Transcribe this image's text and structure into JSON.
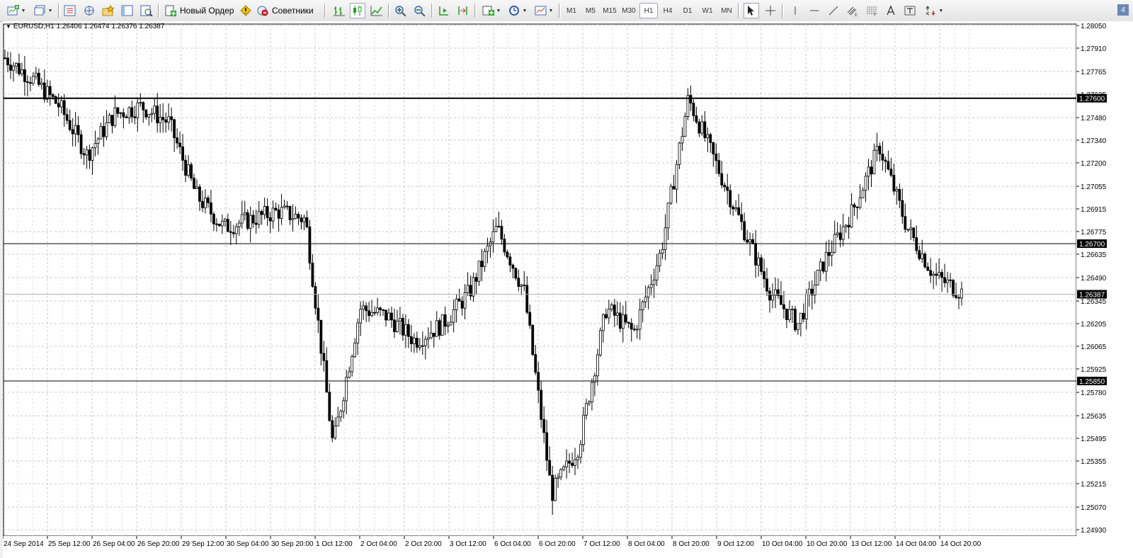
{
  "toolbar": {
    "new_order_label": "Новый Ордер",
    "experts_label": "Советники",
    "timeframes": [
      "M1",
      "M5",
      "M15",
      "M30",
      "H1",
      "H4",
      "D1",
      "W1",
      "MN"
    ],
    "active_timeframe": "H1",
    "corner_badge": "4"
  },
  "chart": {
    "symbol_info": "EURUSD,H1  1.26406 1.26474 1.26376 1.26387",
    "y_ticks": [
      "1.28050",
      "1.27910",
      "1.27765",
      "1.27625",
      "1.27480",
      "1.27340",
      "1.27200",
      "1.27055",
      "1.26915",
      "1.26775",
      "1.26635",
      "1.26490",
      "1.26345",
      "1.26205",
      "1.26065",
      "1.25925",
      "1.25780",
      "1.25635",
      "1.25495",
      "1.25355",
      "1.25215",
      "1.25070",
      "1.24930"
    ],
    "y_tick_values": [
      1.2805,
      1.2791,
      1.27765,
      1.27625,
      1.2748,
      1.2734,
      1.272,
      1.27055,
      1.26915,
      1.26775,
      1.26635,
      1.2649,
      1.26345,
      1.26205,
      1.26065,
      1.25925,
      1.2578,
      1.25635,
      1.25495,
      1.25355,
      1.25215,
      1.2507,
      1.2493
    ],
    "x_ticks": [
      "24 Sep 2014",
      "25 Sep 12:00",
      "26 Sep 04:00",
      "26 Sep 20:00",
      "29 Sep 12:00",
      "30 Sep 04:00",
      "30 Sep 20:00",
      "1 Oct 12:00",
      "2 Oct 04:00",
      "2 Oct 20:00",
      "3 Oct 12:00",
      "6 Oct 04:00",
      "6 Oct 20:00",
      "7 Oct 12:00",
      "8 Oct 04:00",
      "8 Oct 20:00",
      "9 Oct 12:00",
      "10 Oct 04:00",
      "10 Oct 20:00",
      "13 Oct 12:00",
      "14 Oct 04:00",
      "14 Oct 20:00"
    ],
    "h_lines": [
      {
        "label": "1.27600",
        "value": 1.276,
        "weight": "thick"
      },
      {
        "label": "1.26700",
        "value": 1.267,
        "weight": "normal"
      },
      {
        "label": "1.25850",
        "value": 1.2585,
        "weight": "normal"
      }
    ],
    "bid": {
      "label": "1.26387",
      "value": 1.26387
    }
  },
  "chart_data": {
    "type": "candlestick",
    "title": "EURUSD,H1",
    "ylim": [
      1.249,
      1.281
    ],
    "x": [
      "24 Sep 2014",
      "25 Sep 12:00",
      "26 Sep 04:00",
      "26 Sep 20:00",
      "29 Sep 12:00",
      "30 Sep 04:00",
      "30 Sep 20:00",
      "1 Oct 12:00",
      "2 Oct 04:00",
      "2 Oct 20:00",
      "3 Oct 12:00",
      "6 Oct 04:00",
      "6 Oct 20:00",
      "7 Oct 12:00",
      "8 Oct 04:00",
      "8 Oct 20:00",
      "9 Oct 12:00",
      "10 Oct 04:00",
      "10 Oct 20:00",
      "13 Oct 12:00",
      "14 Oct 04:00",
      "14 Oct 20:00"
    ],
    "close_path": [
      1.2785,
      1.2772,
      1.2755,
      1.2725,
      1.275,
      1.2755,
      1.2745,
      1.27,
      1.268,
      1.2685,
      1.269,
      1.2685,
      1.2545,
      1.263,
      1.2625,
      1.261,
      1.262,
      1.264,
      1.268,
      1.264,
      1.2515,
      1.2545,
      1.263,
      1.2615,
      1.2665,
      1.276,
      1.272,
      1.268,
      1.264,
      1.262,
      1.266,
      1.269,
      1.273,
      1.268,
      1.265,
      1.264
    ],
    "grid": true
  }
}
